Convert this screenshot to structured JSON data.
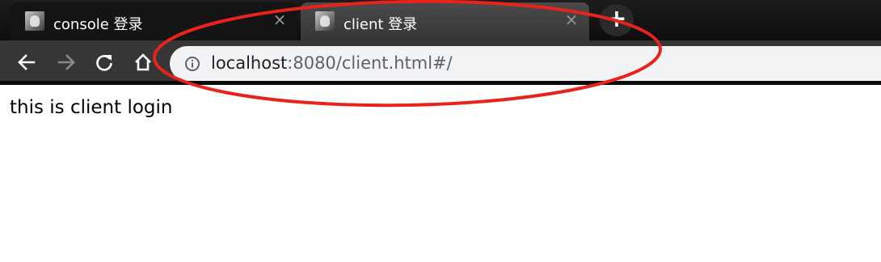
{
  "tabs": [
    {
      "title": "console 登录",
      "active": false,
      "close_glyph": "×",
      "icon": "site-favicon"
    },
    {
      "title": "client 登录",
      "active": true,
      "close_glyph": "×",
      "icon": "site-favicon"
    }
  ],
  "new_tab": {
    "glyph": "+"
  },
  "toolbar": {
    "buttons": [
      "back-icon",
      "forward-icon",
      "reload-icon",
      "home-icon"
    ],
    "forward_enabled": false
  },
  "address_bar": {
    "host": "localhost",
    "rest": ":8080/client.html#/",
    "icon": "info-icon"
  },
  "page": {
    "body_text": "this is client login"
  },
  "annotation": {
    "shape": "ellipse",
    "color": "#e8231b"
  },
  "colors": {
    "tabstrip": "#141414",
    "active_tab": "#3f3f3f",
    "toolbar": "#363636",
    "omnibox": "#f1f3f4",
    "page_background": "#ffffff"
  }
}
